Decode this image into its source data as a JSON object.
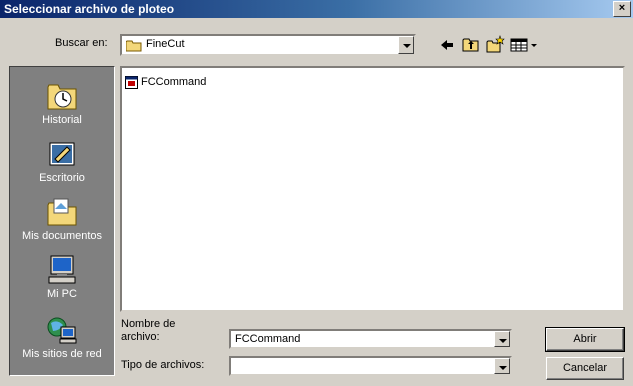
{
  "window": {
    "title": "Seleccionar archivo de ploteo",
    "close_glyph": "×"
  },
  "lookin": {
    "label": "Buscar en:",
    "value": "FineCut"
  },
  "toolbar": {
    "icons": [
      "back-arrow-icon",
      "up-folder-icon",
      "new-folder-icon",
      "view-menu-icon"
    ]
  },
  "places": [
    {
      "label": "Historial",
      "icon": "history-icon"
    },
    {
      "label": "Escritorio",
      "icon": "desktop-icon"
    },
    {
      "label": "Mis documentos",
      "icon": "my-documents-icon"
    },
    {
      "label": "Mi PC",
      "icon": "my-computer-icon"
    },
    {
      "label": "Mis sitios de red",
      "icon": "network-places-icon"
    }
  ],
  "files": [
    {
      "name": "FCCommand"
    }
  ],
  "filename": {
    "label": "Nombre de\narchivo:",
    "value": "FCCommand"
  },
  "filetype": {
    "label": "Tipo de archivos:",
    "value": ""
  },
  "buttons": {
    "open": "Abrir",
    "cancel": "Cancelar"
  },
  "colors": {
    "titlebar_start": "#0a246a",
    "titlebar_end": "#a6caf0",
    "face": "#d4d0c8",
    "places_bg": "#808080"
  }
}
